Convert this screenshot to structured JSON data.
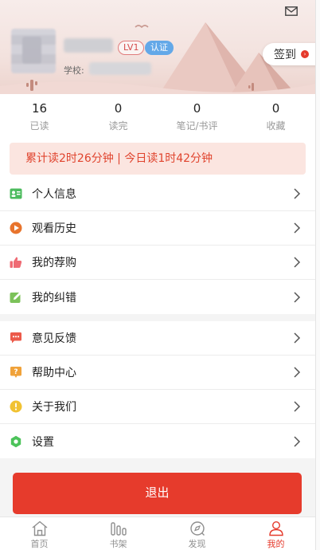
{
  "header": {
    "level_badge": "LV1",
    "verify_badge": "认证",
    "school_label": "学校:",
    "checkin_label": "签到"
  },
  "stats": [
    {
      "value": "16",
      "label": "已读"
    },
    {
      "value": "0",
      "label": "读完"
    },
    {
      "value": "0",
      "label": "笔记/书评"
    },
    {
      "value": "0",
      "label": "收藏"
    }
  ],
  "reading_time": "累计读2时26分钟 | 今日读1时42分钟",
  "menu_group_1": [
    {
      "label": "个人信息",
      "icon": "profile-card-icon",
      "color": "#4cbb5e"
    },
    {
      "label": "观看历史",
      "icon": "play-history-icon",
      "color": "#e8742d"
    },
    {
      "label": "我的荐购",
      "icon": "thumbs-up-icon",
      "color": "#ef6b74"
    },
    {
      "label": "我的纠错",
      "icon": "edit-icon",
      "color": "#7cc25a"
    }
  ],
  "menu_group_2": [
    {
      "label": "意见反馈",
      "icon": "feedback-icon",
      "color": "#ec5a4a"
    },
    {
      "label": "帮助中心",
      "icon": "help-icon",
      "color": "#f0a23a"
    },
    {
      "label": "关于我们",
      "icon": "info-icon",
      "color": "#f1c232"
    },
    {
      "label": "设置",
      "icon": "settings-icon",
      "color": "#4cc35a"
    }
  ],
  "logout_label": "退出",
  "tabs": [
    {
      "label": "首页",
      "icon": "home-icon"
    },
    {
      "label": "书架",
      "icon": "bookshelf-icon"
    },
    {
      "label": "发现",
      "icon": "discover-icon"
    },
    {
      "label": "我的",
      "icon": "profile-icon",
      "active": true
    }
  ],
  "colors": {
    "accent": "#e63b2c",
    "reading_bg": "#fbe5e0",
    "verify": "#63a8e8"
  }
}
